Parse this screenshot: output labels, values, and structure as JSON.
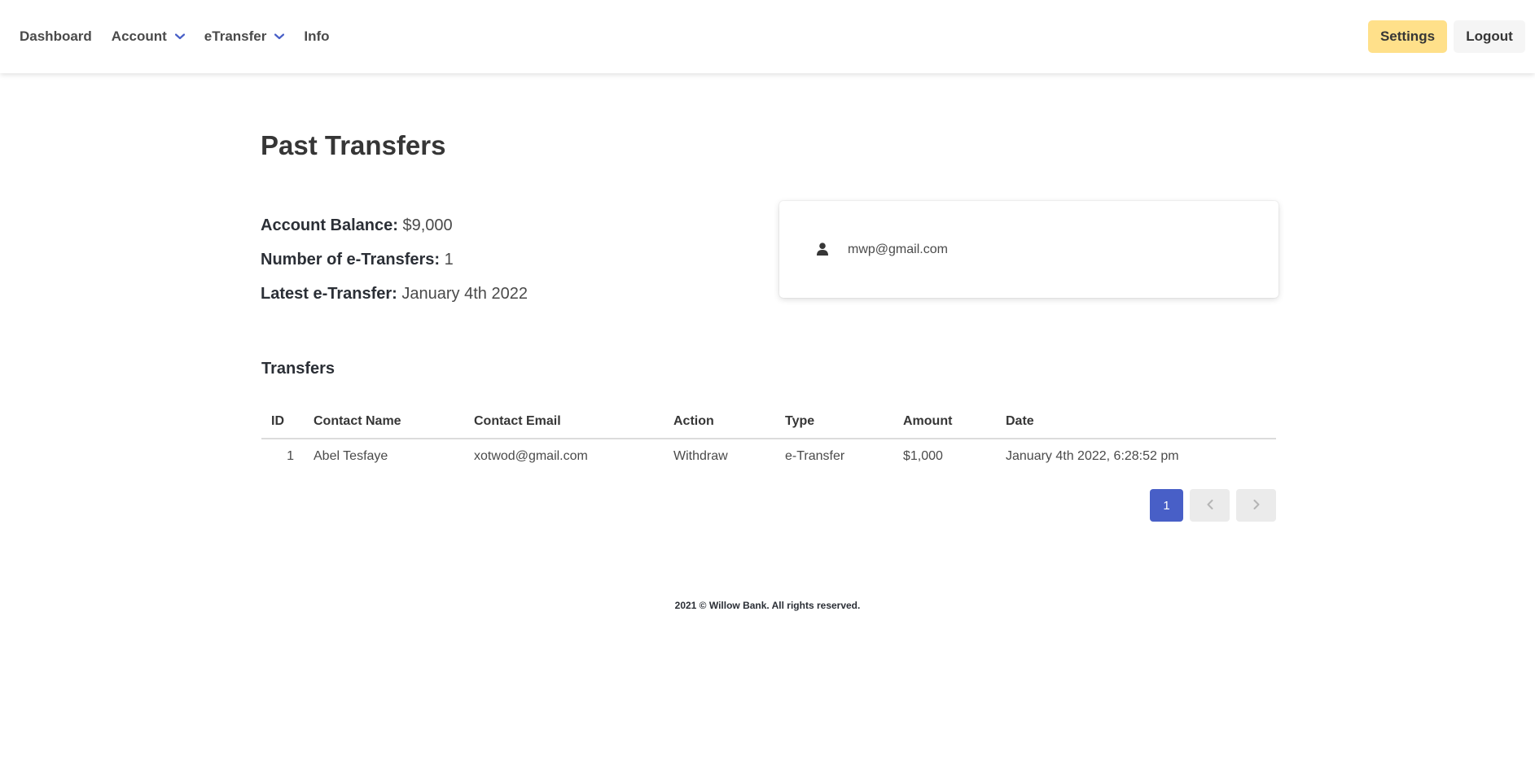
{
  "nav": {
    "items": [
      {
        "label": "Dashboard"
      },
      {
        "label": "Account"
      },
      {
        "label": "eTransfer"
      },
      {
        "label": "Info"
      }
    ],
    "settings_label": "Settings",
    "logout_label": "Logout"
  },
  "page": {
    "title": "Past Transfers"
  },
  "stats": {
    "balance_label": "Account Balance:",
    "balance_value": "$9,000",
    "count_label": "Number of e-Transfers:",
    "count_value": "1",
    "latest_label": "Latest e-Transfer:",
    "latest_value": "January 4th 2022"
  },
  "user_card": {
    "email": "mwp@gmail.com"
  },
  "transfers": {
    "title": "Transfers",
    "columns": [
      "ID",
      "Contact Name",
      "Contact Email",
      "Action",
      "Type",
      "Amount",
      "Date"
    ],
    "rows": [
      [
        "1",
        "Abel Tesfaye",
        "xotwod@gmail.com",
        "Withdraw",
        "e-Transfer",
        "$1,000",
        "January 4th 2022, 6:28:52 pm"
      ]
    ]
  },
  "pagination": {
    "current_page": "1"
  },
  "footer": {
    "text": "2021 © Willow Bank. All rights reserved."
  },
  "colors": {
    "primary": "#485fc7",
    "settings_bg": "#ffe08a",
    "logout_bg": "#f5f5f5"
  }
}
